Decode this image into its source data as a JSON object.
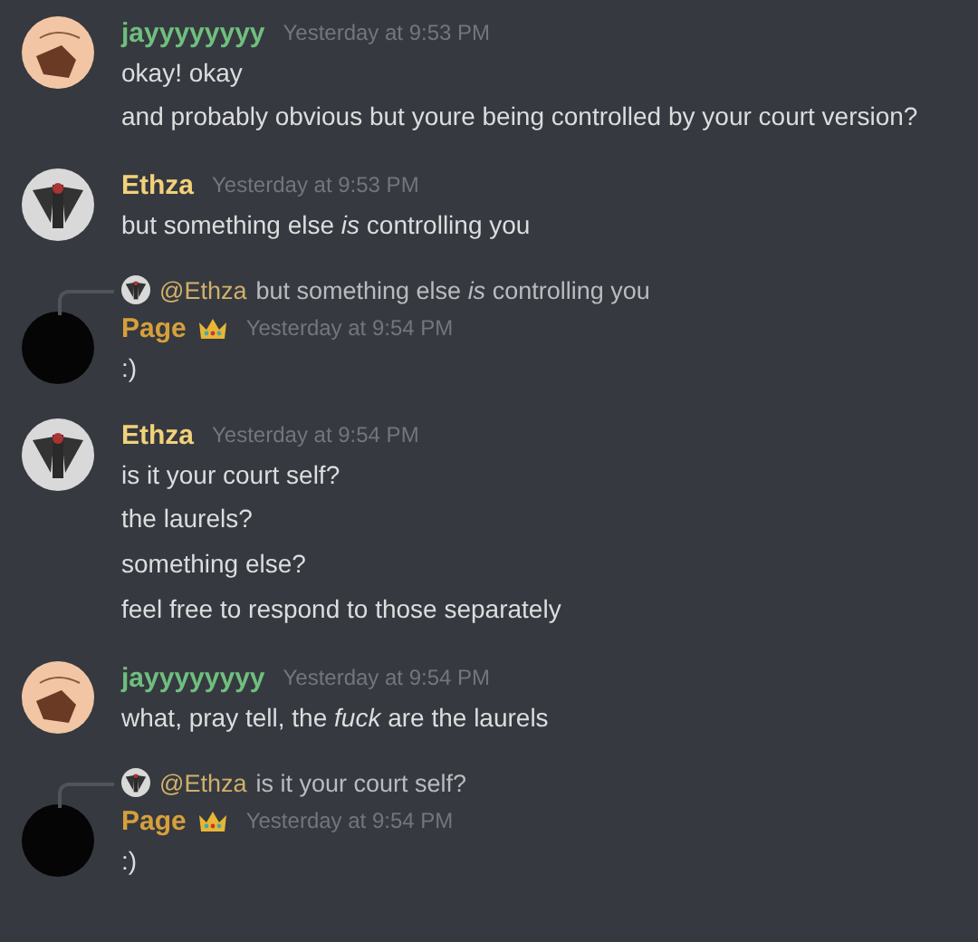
{
  "messages": [
    {
      "author": "jayyyyyyyy",
      "color": "#6fbf7f",
      "avatar": {
        "kind": "sketch"
      },
      "crown": false,
      "timestamp": "Yesterday at 9:53 PM",
      "lines": [
        "okay! okay",
        "and probably obvious but youre being controlled by your court version?"
      ]
    },
    {
      "author": "Ethza",
      "color": "#f1d27a",
      "avatar": {
        "kind": "figure"
      },
      "crown": false,
      "timestamp": "Yesterday at 9:53 PM",
      "lines": [
        "but something else *is* controlling you"
      ]
    },
    {
      "author": "Page",
      "color": "#d6a03b",
      "avatar": {
        "kind": "blank"
      },
      "crown": true,
      "timestamp": "Yesterday at 9:54 PM",
      "reply": {
        "mention": "@Ethza",
        "text": "but something else *is* controlling you"
      },
      "lines": [
        ":)"
      ]
    },
    {
      "author": "Ethza",
      "color": "#f1d27a",
      "avatar": {
        "kind": "figure"
      },
      "crown": false,
      "timestamp": "Yesterday at 9:54 PM",
      "lines": [
        "is it your court self?",
        "the laurels?",
        "something else?",
        "feel free to respond to those separately"
      ]
    },
    {
      "author": "jayyyyyyyy",
      "color": "#6fbf7f",
      "avatar": {
        "kind": "sketch"
      },
      "crown": false,
      "timestamp": "Yesterday at 9:54 PM",
      "lines": [
        "what, pray tell, the *fuck* are the laurels"
      ]
    },
    {
      "author": "Page",
      "color": "#d6a03b",
      "avatar": {
        "kind": "blank"
      },
      "crown": true,
      "timestamp": "Yesterday at 9:54 PM",
      "reply": {
        "mention": "@Ethza",
        "text": "is it your court self?"
      },
      "lines": [
        ":)"
      ]
    }
  ]
}
